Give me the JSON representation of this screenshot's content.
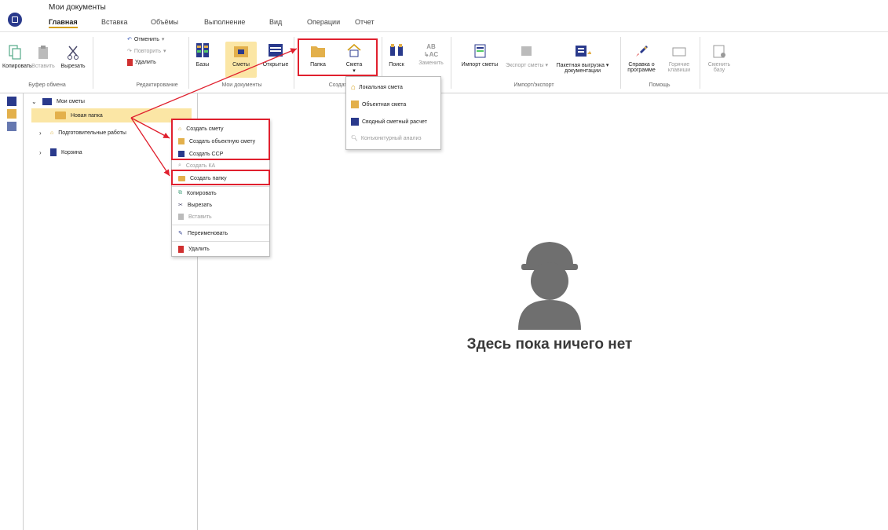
{
  "app": {
    "title": "Мои документы"
  },
  "tabs": [
    "Главная",
    "Вставка",
    "Объёмы",
    "Выполнение",
    "Вид",
    "Операции",
    "Отчет"
  ],
  "ribbon": {
    "copy": "Копировать",
    "paste": "Вставить",
    "cut": "Вырезать",
    "undo": "Отменить",
    "redo": "Повторить",
    "delete": "Удалить",
    "bases": "Базы",
    "estimates": "Сметы",
    "open": "Открытые",
    "folder": "Папка",
    "estimate": "Смета",
    "search": "Поиск",
    "replace": "Заменить",
    "import": "Импорт сметы",
    "export": "Экспорт сметы",
    "batch_line1": "Пакетная выгрузка",
    "batch_line2": "документации",
    "about_line1": "Справка о",
    "about_line2": "программе",
    "hotkeys_line1": "Горячие",
    "hotkeys_line2": "клавиши",
    "change_line1": "Сменить",
    "change_line2": "базу",
    "groups": {
      "clipboard": "Буфер обмена",
      "editing": "Редактирование",
      "mydocs": "Мои документы",
      "create": "Создать",
      "impexp": "Импорт/экспорт",
      "help": "Помощь"
    }
  },
  "estimate_dropdown": [
    "Локальная смета",
    "Объектная смета",
    "Сводный сметный расчет",
    "Конъюнктурный анализ"
  ],
  "tree": {
    "root": "Мои сметы",
    "new_folder": "Новая папка",
    "prep": "Подготовительные работы",
    "trash": "Корзина"
  },
  "context_menu": {
    "create_estimate": "Создать смету",
    "create_object": "Создать объектную смету",
    "create_ssr": "Создать ССР",
    "create_ka": "Создать КА",
    "create_folder": "Создать папку",
    "copy": "Копировать",
    "cut": "Вырезать",
    "paste": "Вставить",
    "rename": "Переименовать",
    "delete": "Удалить"
  },
  "empty_state": {
    "text": "Здесь пока ничего нет"
  },
  "colors": {
    "accent_red": "#e0202e",
    "folder": "#e3b04b",
    "selected_bg": "#fbe6a5",
    "brand": "#2a3a8c"
  }
}
